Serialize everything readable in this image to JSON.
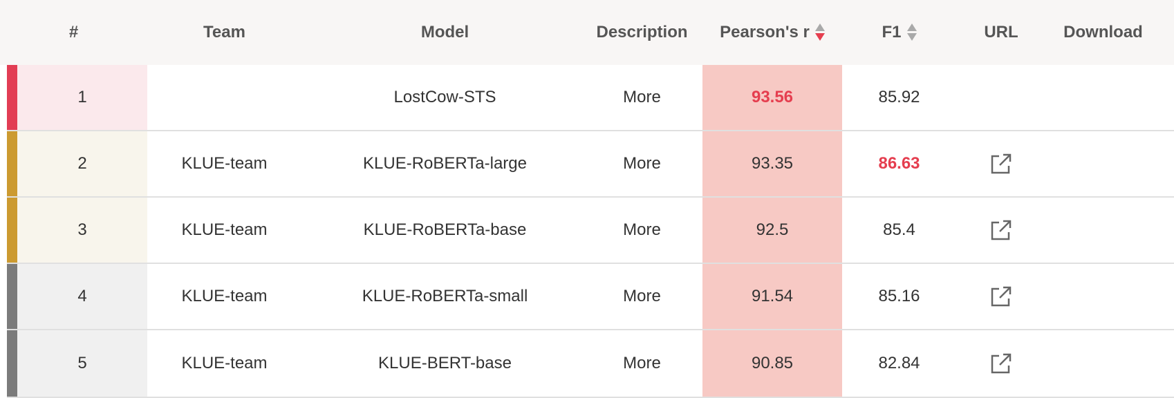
{
  "colors": {
    "header_bg": "#f8f6f5",
    "highlight_column_bg": "#f7c9c4",
    "best_value": "#e53e4f",
    "rank_1_bar": "#e23d54",
    "rank_1_bg": "#fbe9ec",
    "rank_gold_bar": "#cc9a30",
    "rank_gold_bg": "#f8f5ec",
    "rank_gray_bar": "#7b7b7b",
    "rank_gray_bg": "#f0f0f0"
  },
  "header": {
    "rank": "#",
    "team": "Team",
    "model": "Model",
    "description": "Description",
    "pearson": "Pearson's r",
    "f1": "F1",
    "url": "URL",
    "download": "Download"
  },
  "rows": [
    {
      "rank": "1",
      "team": "",
      "model": "LostCow-STS",
      "description": "More",
      "pearson": "93.56",
      "f1": "85.92",
      "url_icon": "external-link-icon",
      "has_url": false
    },
    {
      "rank": "2",
      "team": "KLUE-team",
      "model": "KLUE-RoBERTa-large",
      "description": "More",
      "pearson": "93.35",
      "f1": "86.63",
      "url_icon": "external-link-icon",
      "has_url": true
    },
    {
      "rank": "3",
      "team": "KLUE-team",
      "model": "KLUE-RoBERTa-base",
      "description": "More",
      "pearson": "92.5",
      "f1": "85.4",
      "url_icon": "external-link-icon",
      "has_url": true
    },
    {
      "rank": "4",
      "team": "KLUE-team",
      "model": "KLUE-RoBERTa-small",
      "description": "More",
      "pearson": "91.54",
      "f1": "85.16",
      "url_icon": "external-link-icon",
      "has_url": true
    },
    {
      "rank": "5",
      "team": "KLUE-team",
      "model": "KLUE-BERT-base",
      "description": "More",
      "pearson": "90.85",
      "f1": "82.84",
      "url_icon": "external-link-icon",
      "has_url": true
    }
  ]
}
